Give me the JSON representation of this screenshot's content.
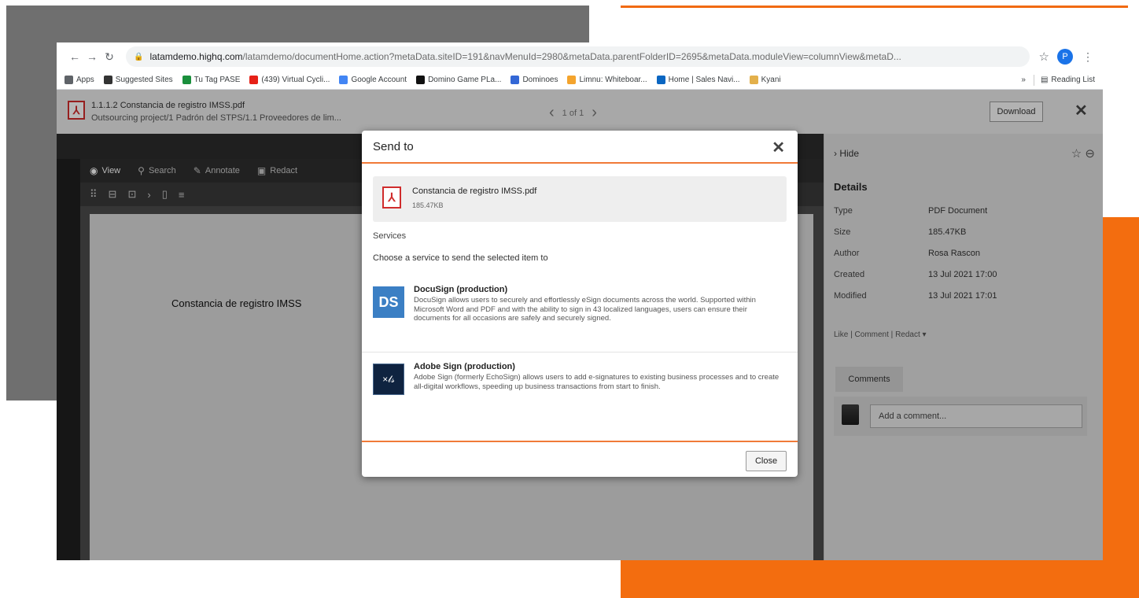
{
  "browser": {
    "url_host": "latamdemo.highq.com",
    "url_rest": "/latamdemo/documentHome.action?metaData.siteID=191&navMenuId=2980&metaData.parentFolderID=2695&metaData.moduleView=columnView&metaD...",
    "profile_initial": "P",
    "bookmarks": [
      {
        "label": "Apps",
        "color": "#5f6368"
      },
      {
        "label": "Suggested Sites",
        "color": "#333333"
      },
      {
        "label": "Tu Tag PASE",
        "color": "#1a8f3c"
      },
      {
        "label": "(439) Virtual Cycli...",
        "color": "#e62117"
      },
      {
        "label": "Google Account",
        "color": "#4285f4"
      },
      {
        "label": "Domino Game PLa...",
        "color": "#111111"
      },
      {
        "label": "Dominoes",
        "color": "#3367d6"
      },
      {
        "label": "Limnu: Whiteboar...",
        "color": "#f4a42d"
      },
      {
        "label": "Home | Sales Navi...",
        "color": "#0a66c2"
      },
      {
        "label": "Kyani",
        "color": "#e3b04b"
      }
    ],
    "bookmarks_more": "»",
    "reading_list": "Reading List"
  },
  "doc_header": {
    "title": "1.1.1.2 Constancia de registro IMSS.pdf",
    "path": "Outsourcing project/1 Padrón del STPS/1.1 Proveedores de lim...",
    "page_indicator": "1 of 1",
    "download_label": "Download"
  },
  "viewer": {
    "tabs": [
      {
        "icon": "◉",
        "label": "View"
      },
      {
        "icon": "⚲",
        "label": "Search"
      },
      {
        "icon": "✎",
        "label": "Annotate"
      },
      {
        "icon": "▣",
        "label": "Redact"
      }
    ],
    "page_text": "Constancia de registro IMSS"
  },
  "side": {
    "hide_label": "Hide",
    "details_heading": "Details",
    "details": [
      {
        "key": "Type",
        "value": "PDF Document"
      },
      {
        "key": "Size",
        "value": "185.47KB"
      },
      {
        "key": "Author",
        "value": "Rosa Rascon"
      },
      {
        "key": "Created",
        "value": "13 Jul 2021 17:00"
      },
      {
        "key": "Modified",
        "value": "13 Jul 2021 17:01"
      }
    ],
    "actions": {
      "like": "Like",
      "comment": "Comment",
      "redact": "Redact"
    },
    "comments_tab": "Comments",
    "comment_placeholder": "Add a comment..."
  },
  "modal": {
    "title": "Send to",
    "file_name": "Constancia de registro IMSS.pdf",
    "file_size": "185.47KB",
    "services_heading": "Services",
    "services_subtitle": "Choose a service to send the selected item to",
    "services": [
      {
        "name": "DocuSign (production)",
        "logo": "DS",
        "description": "DocuSign allows users to securely and effortlessly eSign documents across the world. Supported within Microsoft Word and PDF and with the ability to sign in 43 localized languages, users can ensure their documents for all occasions are safely and securely signed."
      },
      {
        "name": "Adobe Sign (production)",
        "logo": "×𝓁𝓈",
        "description": "Adobe Sign (formerly EchoSign) allows users to add e-signatures to existing business processes and to create all-digital workflows, speeding up business transactions from start to finish."
      }
    ],
    "close_label": "Close"
  },
  "colors": {
    "accent_orange": "#f36d0f",
    "modal_rule": "#f07a38",
    "pdf_red": "#d02c2c",
    "docusign_blue": "#3b7fc4"
  }
}
